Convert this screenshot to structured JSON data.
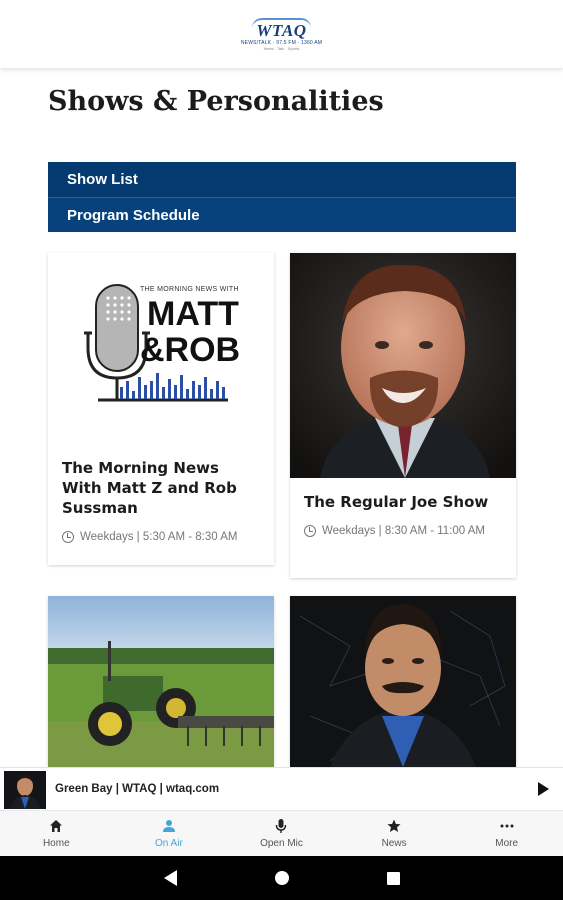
{
  "header": {
    "logo_text": "WTAQ",
    "logo_sub": "NEWS/TALK · 97.5 FM · 1360 AM",
    "logo_sub2": "News · Talk · Sports"
  },
  "page_title": "Shows & Personalities",
  "menu": {
    "items": [
      {
        "label": "Show List"
      },
      {
        "label": "Program Schedule"
      }
    ]
  },
  "shows": [
    {
      "title": "The Morning News With Matt Z and Rob Sussman",
      "time": "Weekdays | 5:30 AM - 8:30 AM",
      "logo_top": "THE MORNING NEWS WITH",
      "logo_name1": "MATT",
      "logo_name2": "&ROB"
    },
    {
      "title": "The Regular Joe Show",
      "time": "Weekdays | 8:30 AM - 11:00 AM"
    },
    {
      "title": "",
      "time": ""
    },
    {
      "title": "",
      "time": ""
    }
  ],
  "now_playing": {
    "station": "Green Bay | WTAQ | wtaq.com"
  },
  "tabs": [
    {
      "label": "Home",
      "icon": "home-icon",
      "active": false
    },
    {
      "label": "On Air",
      "icon": "person-icon",
      "active": true
    },
    {
      "label": "Open Mic",
      "icon": "microphone-icon",
      "active": false
    },
    {
      "label": "News",
      "icon": "star-icon",
      "active": false
    },
    {
      "label": "More",
      "icon": "more-icon",
      "active": false
    }
  ],
  "colors": {
    "brand_blue": "#07427d",
    "active_tab": "#42a7d8"
  }
}
